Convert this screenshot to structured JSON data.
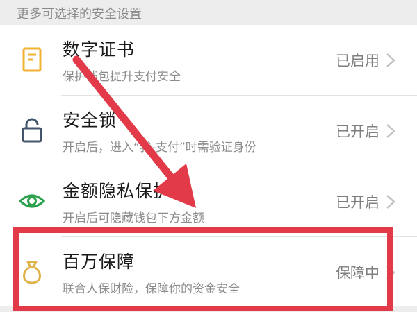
{
  "section": {
    "header": "更多可选择的安全设置"
  },
  "items": [
    {
      "icon": "certificate-icon",
      "title": "数字证书",
      "subtitle": "保护钱包提升支付安全",
      "status": "已启用"
    },
    {
      "icon": "lock-icon",
      "title": "安全锁",
      "subtitle": "开启后，进入“我-支付”时需验证身份",
      "status": "已开启"
    },
    {
      "icon": "eye-icon",
      "title": "金额隐私保护",
      "subtitle": "开启后可隐藏钱包下方金额",
      "status": "已开启"
    },
    {
      "icon": "money-bag-icon",
      "title": "百万保障",
      "subtitle": "联合人保财险，保障你的资金安全",
      "status": "保障中"
    }
  ],
  "colors": {
    "certificate": "#f2b233",
    "lock": "#44546a",
    "eye": "#2aa14a",
    "money_bag": "#e0b24a",
    "annotation": "#e23a48"
  }
}
